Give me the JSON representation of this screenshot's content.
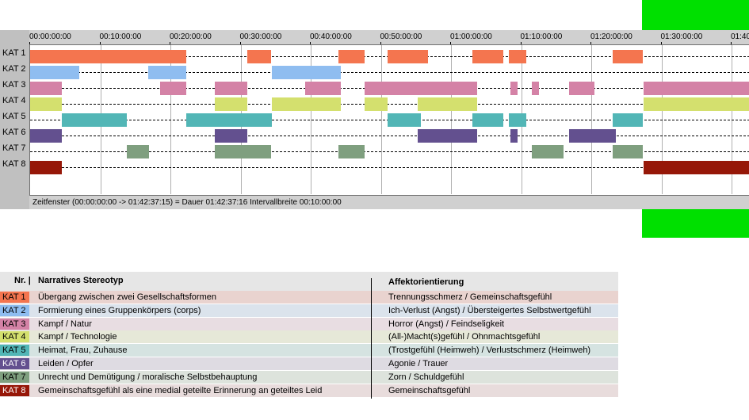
{
  "ruler": {
    "ticks": [
      "00:00:00:00",
      "00:10:00:00",
      "00:20:00:00",
      "00:30:00:00",
      "00:40:00:00",
      "00:50:00:00",
      "01:00:00:00",
      "01:10:00:00",
      "01:20:00:00",
      "01:30:00:00",
      "01:40"
    ]
  },
  "categories": [
    {
      "label": "KAT 1",
      "color": "#f4754f",
      "segments": [
        [
          0,
          22.3
        ],
        [
          31,
          34.3
        ],
        [
          44,
          47.7
        ],
        [
          51,
          56.7
        ],
        [
          63,
          67.5
        ],
        [
          68.3,
          70.7
        ],
        [
          83,
          87.3
        ]
      ]
    },
    {
      "label": "KAT 2",
      "color": "#8fbdf0",
      "segments": [
        [
          0,
          7
        ],
        [
          16.8,
          22.3
        ],
        [
          34.5,
          44.3
        ]
      ]
    },
    {
      "label": "KAT 3",
      "color": "#d482a6",
      "segments": [
        [
          0,
          4.5
        ],
        [
          18.5,
          22.3
        ],
        [
          26.3,
          31
        ],
        [
          39.2,
          44.3
        ],
        [
          47.7,
          63.7
        ],
        [
          68.5,
          69.5
        ],
        [
          71.5,
          72.5
        ],
        [
          76.8,
          80.5
        ],
        [
          87.5,
          103
        ]
      ]
    },
    {
      "label": "KAT 4",
      "color": "#d4e06e",
      "segments": [
        [
          0,
          4.5
        ],
        [
          26.3,
          31
        ],
        [
          34.5,
          44.3
        ],
        [
          47.7,
          51
        ],
        [
          55.3,
          63.7
        ],
        [
          87.5,
          103
        ]
      ]
    },
    {
      "label": "KAT 5",
      "color": "#52b6b6",
      "segments": [
        [
          4.5,
          13.8
        ],
        [
          22.3,
          34.5
        ],
        [
          51,
          55.7
        ],
        [
          63,
          67.5
        ],
        [
          68.3,
          70.7
        ],
        [
          83,
          87.3
        ]
      ]
    },
    {
      "label": "KAT 6",
      "color": "#63508f",
      "segments": [
        [
          0,
          4.5
        ],
        [
          26.3,
          31
        ],
        [
          55.3,
          63.7
        ],
        [
          68.5,
          69.5
        ],
        [
          76.8,
          83.5
        ]
      ]
    },
    {
      "label": "KAT 7",
      "color": "#7f9f7f",
      "segments": [
        [
          13.8,
          17
        ],
        [
          26.3,
          34.3
        ],
        [
          44,
          47.7
        ],
        [
          71.5,
          76
        ],
        [
          83,
          87.3
        ]
      ]
    },
    {
      "label": "KAT 8",
      "color": "#961708",
      "segments": [
        [
          0,
          4.5
        ],
        [
          87.5,
          103
        ]
      ]
    }
  ],
  "status": "Zeitfenster (00:00:00:00 -> 01:42:37:15) = Dauer 01:42:37:16    Intervallbreite 00:10:00:00",
  "legend": {
    "col_nr": "Nr. |",
    "col_stereotype": "Narratives Stereotyp",
    "col_affect": "Affektorientierung",
    "rows": [
      {
        "tag": "KAT 1",
        "bg": "#e9d3cf",
        "stereotype": "Übergang zwischen zwei Gesellschaftsformen",
        "affect": "Trennungsschmerz / Gemeinschaftsgefühl"
      },
      {
        "tag": "KAT 2",
        "bg": "#dbe3ec",
        "stereotype": "Formierung eines Gruppenkörpers (corps)",
        "affect": "Ich-Verlust (Angst) / Übersteigertes Selbstwertgefühl"
      },
      {
        "tag": "KAT 3",
        "bg": "#e8dde2",
        "stereotype": "Kampf / Natur",
        "affect": "Horror (Angst) / Feindseligkeit"
      },
      {
        "tag": "KAT 4",
        "bg": "#e6e8d8",
        "stereotype": "Kampf / Technologie",
        "affect": "(All-)Macht(s)gefühl / Ohnmachtsgefühl"
      },
      {
        "tag": "KAT 5",
        "bg": "#d5e3e1",
        "stereotype": "Heimat, Frau, Zuhause",
        "affect": "(Trostgefühl (Heimweh) / Verlustschmerz (Heimweh)"
      },
      {
        "tag": "KAT 6",
        "bg": "#dedbe2",
        "stereotype": "Leiden / Opfer",
        "affect": "Agonie / Trauer"
      },
      {
        "tag": "KAT 7",
        "bg": "#dde3dc",
        "stereotype": "Unrecht und Demütigung / moralische Selbstbehauptung",
        "affect": "Zorn / Schuldgefühl"
      },
      {
        "tag": "KAT 8",
        "bg": "#e8dcdc",
        "stereotype": "Gemeinschaftsgefühl als eine medial geteilte Erinnerung an geteiltes Leid",
        "affect": "Gemeinschaftsgefühl"
      }
    ]
  }
}
